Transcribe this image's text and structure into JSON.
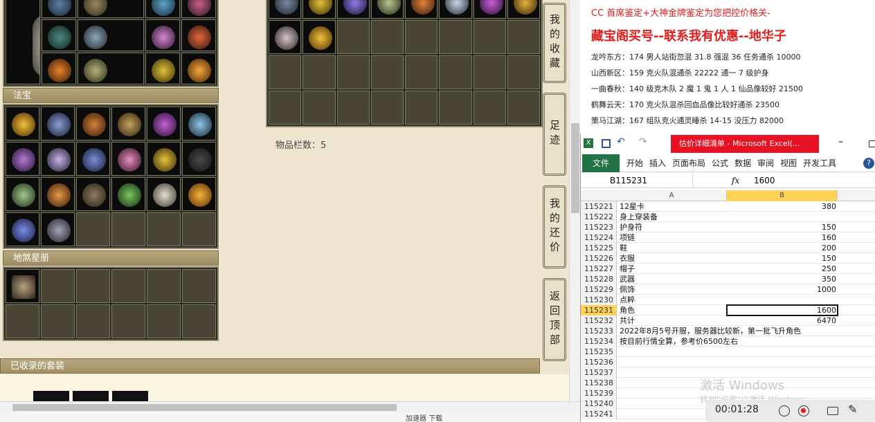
{
  "game": {
    "fabao_header": "法宝",
    "dishastar_header": "地煞星册",
    "suits_header": "已收录的套装",
    "item_count_label": "物品栏数：5",
    "side_tabs": [
      {
        "id": "my-collection",
        "label": "我的收藏"
      },
      {
        "id": "footprint",
        "label": "足迹"
      },
      {
        "id": "my-counter-offer",
        "label": "我的还价"
      },
      {
        "id": "back-to-top",
        "label": "返回顶部"
      }
    ],
    "status_bar": "加速器   下载"
  },
  "notes": {
    "line_top": "CC 首席鉴定+大神金牌鉴定为您把控价格关-",
    "line_big": "藏宝阁买号--联系我有优惠--地华子",
    "listings": [
      "龙吟东方：174 男人站街忽混 31.8 强混 36 任务通杀 10000",
      "山西新区：159 克火队混通杀 22222 通一 7 级护身",
      "一曲春秋：140 级克木队 2 魔 1 鬼 1 人 1 仙品像较好 21500",
      "鹤舞云天：170 克火队混杀回血品像比较好通杀 23500",
      "策马江湖：167 组队克火通灵睡杀 14-15 没压力 82000"
    ]
  },
  "excel": {
    "title": "估价详细清单 - Microsoft Excel(...",
    "file_tab": "文件",
    "ribbon_tabs": [
      "开始",
      "插入",
      "页面布局",
      "公式",
      "数据",
      "审阅",
      "视图",
      "开发工具"
    ],
    "name_box": "B115231",
    "fx_label": "fx",
    "formula_value": "1600",
    "col_a": "A",
    "col_b": "B",
    "rows": [
      {
        "n": "115221",
        "a": "12星卡",
        "b": "380"
      },
      {
        "n": "115222",
        "a": "身上穿装备",
        "b": ""
      },
      {
        "n": "115223",
        "a": "护身符",
        "b": "150"
      },
      {
        "n": "115224",
        "a": "项链",
        "b": "160"
      },
      {
        "n": "115225",
        "a": "鞋",
        "b": "200"
      },
      {
        "n": "115226",
        "a": "衣服",
        "b": "150"
      },
      {
        "n": "115227",
        "a": "帽子",
        "b": "250"
      },
      {
        "n": "115228",
        "a": "武器",
        "b": "350"
      },
      {
        "n": "115229",
        "a": "佩饰",
        "b": "1000"
      },
      {
        "n": "115230",
        "a": "点粹",
        "b": ""
      },
      {
        "n": "115231",
        "a": "角色",
        "b": "1600"
      },
      {
        "n": "115232",
        "a": "共计",
        "b": "6470"
      },
      {
        "n": "115233",
        "a": "2022年8月5号开服，服务器比较新，第一批飞升角色",
        "b": ""
      },
      {
        "n": "115234",
        "a": "按目前行情全算，参考价6500左右",
        "b": ""
      },
      {
        "n": "115235",
        "a": "",
        "b": ""
      },
      {
        "n": "115236",
        "a": "",
        "b": ""
      },
      {
        "n": "115237",
        "a": "",
        "b": ""
      },
      {
        "n": "115238",
        "a": "",
        "b": ""
      },
      {
        "n": "115239",
        "a": "",
        "b": ""
      },
      {
        "n": "115240",
        "a": "",
        "b": ""
      },
      {
        "n": "115241",
        "a": "",
        "b": ""
      }
    ],
    "active_row": "115231",
    "watermark_title": "激活 Windows",
    "watermark_sub": "转到\"设置\"以激活 Windows。"
  },
  "recorder": {
    "time": "00:01:28"
  },
  "colors": {
    "excel_green": "#217346",
    "title_red": "#e81123",
    "note_red": "#e21b1b",
    "selected_header": "#ffd257"
  }
}
